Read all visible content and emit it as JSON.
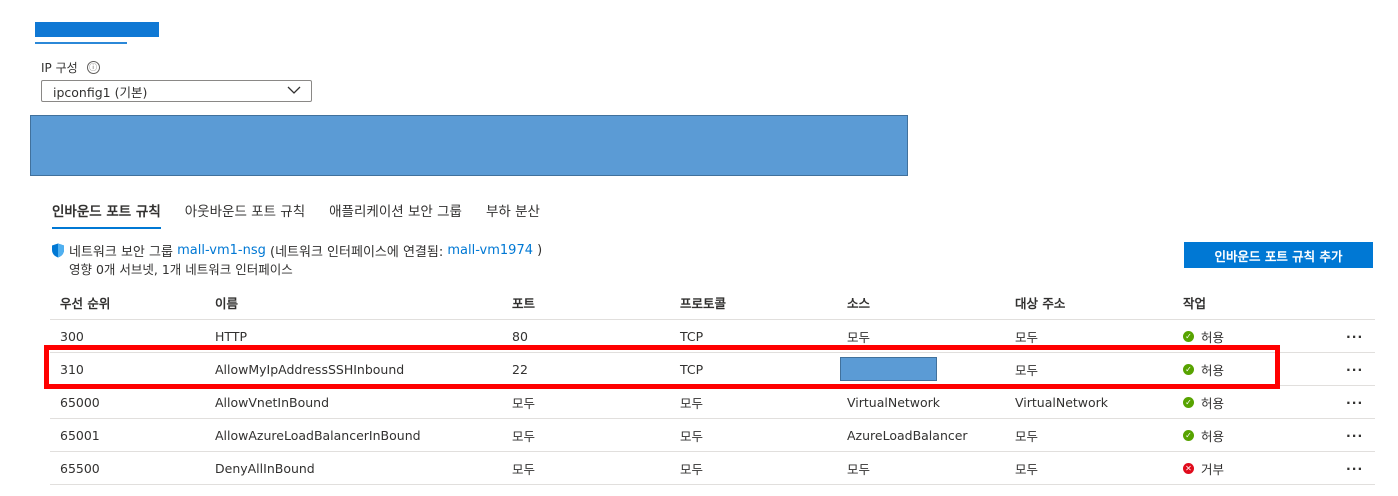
{
  "ip_config": {
    "label": "IP 구성",
    "info_icon": "ⓘ",
    "selected": "ipconfig1 (기본)"
  },
  "tabs": [
    {
      "label": "인바운드 포트 규칙",
      "active": true
    },
    {
      "label": "아웃바운드 포트 규칙",
      "active": false
    },
    {
      "label": "애플리케이션 보안 그룹",
      "active": false
    },
    {
      "label": "부하 분산",
      "active": false
    }
  ],
  "nsg": {
    "prefix": "네트워크 보안 그룹",
    "nsg_name": "mall-vm1-nsg",
    "middle": "(네트워크 인터페이스에 연결됨:",
    "nic_name": "mall-vm1974",
    "suffix": ")",
    "impact": "영향 0개 서브넷, 1개 네트워크 인터페이스"
  },
  "add_rule_button": "인바운드 포트 규칙 추가",
  "table": {
    "headers": {
      "priority": "우선 순위",
      "name": "이름",
      "port": "포트",
      "protocol": "프로토콜",
      "source": "소스",
      "destination": "대상 주소",
      "action": "작업"
    },
    "rows": [
      {
        "priority": "300",
        "name": "HTTP",
        "port": "80",
        "protocol": "TCP",
        "source": "모두",
        "destination": "모두",
        "action": "허용",
        "action_type": "allow",
        "more": "···"
      },
      {
        "priority": "310",
        "name": "AllowMyIpAddressSSHInbound",
        "port": "22",
        "protocol": "TCP",
        "source": "",
        "destination": "모두",
        "action": "허용",
        "action_type": "allow",
        "more": "···"
      },
      {
        "priority": "65000",
        "name": "AllowVnetInBound",
        "port": "모두",
        "protocol": "모두",
        "source": "VirtualNetwork",
        "destination": "VirtualNetwork",
        "action": "허용",
        "action_type": "allow",
        "more": "···"
      },
      {
        "priority": "65001",
        "name": "AllowAzureLoadBalancerInBound",
        "port": "모두",
        "protocol": "모두",
        "source": "AzureLoadBalancer",
        "destination": "모두",
        "action": "허용",
        "action_type": "allow",
        "more": "···"
      },
      {
        "priority": "65500",
        "name": "DenyAllInBound",
        "port": "모두",
        "protocol": "모두",
        "source": "모두",
        "destination": "모두",
        "action": "거부",
        "action_type": "deny",
        "more": "···"
      }
    ]
  },
  "colors": {
    "accent": "#0078d4",
    "allow": "#57a300",
    "deny": "#e00b1c",
    "highlight": "#ff0000",
    "redaction": "#5b9bd5"
  },
  "icons": {
    "info": "info-icon",
    "dropdown": "chevron-down-icon",
    "nsg": "shield-icon",
    "allow": "check-circle-icon",
    "deny": "x-circle-icon",
    "more": "more-icon"
  }
}
